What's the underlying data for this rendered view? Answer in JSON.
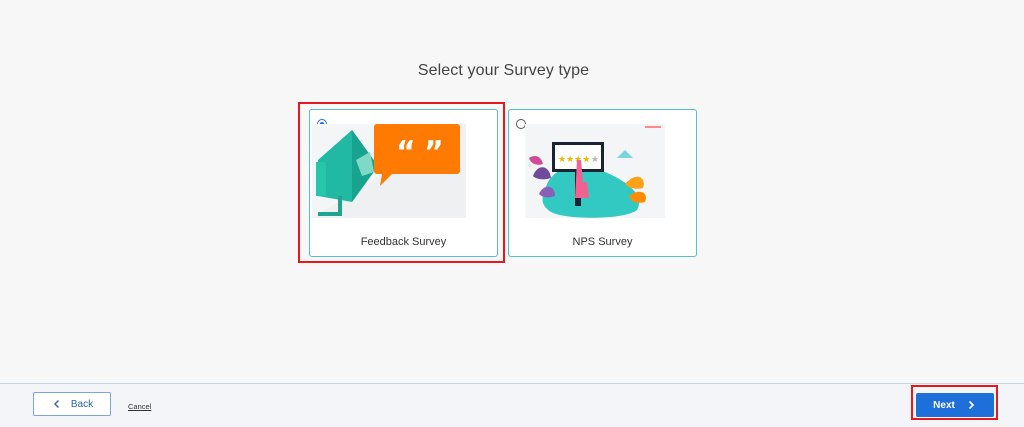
{
  "page": {
    "title": "Select your Survey type"
  },
  "survey_types": [
    {
      "label": "Feedback Survey",
      "selected": true,
      "icon": "megaphone-illustration"
    },
    {
      "label": "NPS Survey",
      "selected": false,
      "icon": "rating-tablet-illustration"
    }
  ],
  "footer": {
    "back_label": "Back",
    "cancel_label": "Cancel",
    "next_label": "Next"
  },
  "colors": {
    "accent": "#1e6fd9",
    "card_border": "#5bbccc",
    "highlight": "#e3191e",
    "teal": "#25c0a6",
    "orange": "#ff7a00"
  }
}
